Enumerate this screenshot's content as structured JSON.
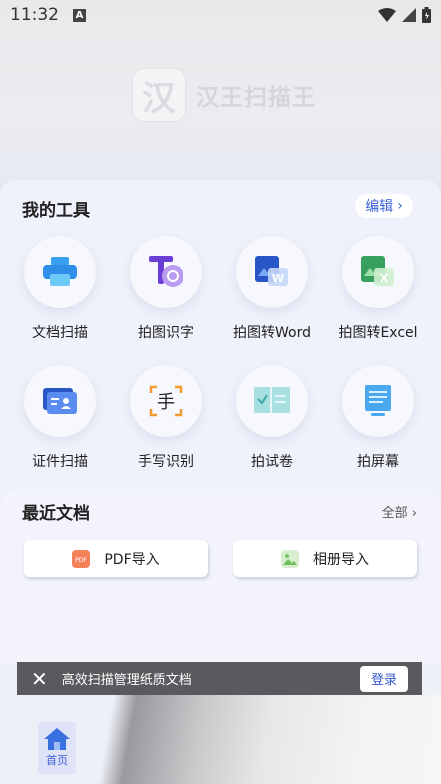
{
  "status_bar": {
    "time": "11:32",
    "badge": "A"
  },
  "brand": {
    "logo_char": "汉",
    "name": "汉王扫描王"
  },
  "tools": {
    "title": "我的工具",
    "edit_label": "编辑",
    "items": [
      {
        "label": "文档扫描",
        "icon": "printer-icon"
      },
      {
        "label": "拍图识字",
        "icon": "text-recognition-icon"
      },
      {
        "label": "拍图转Word",
        "icon": "word-icon"
      },
      {
        "label": "拍图转Excel",
        "icon": "excel-icon"
      },
      {
        "label": "证件扫描",
        "icon": "id-card-icon"
      },
      {
        "label": "手写识别",
        "icon": "handwriting-icon"
      },
      {
        "label": "拍试卷",
        "icon": "exam-paper-icon"
      },
      {
        "label": "拍屏幕",
        "icon": "screen-icon"
      }
    ]
  },
  "recent": {
    "title": "最近文档",
    "all_label": "全部",
    "pdf_import": "PDF导入",
    "album_import": "相册导入"
  },
  "toast": {
    "message": "高效扫描管理纸质文档",
    "login_label": "登录"
  },
  "bottom_nav": {
    "home_label": "首页"
  },
  "colors": {
    "accent": "#3b63d8",
    "toast_bg": "#5a5a5e"
  }
}
